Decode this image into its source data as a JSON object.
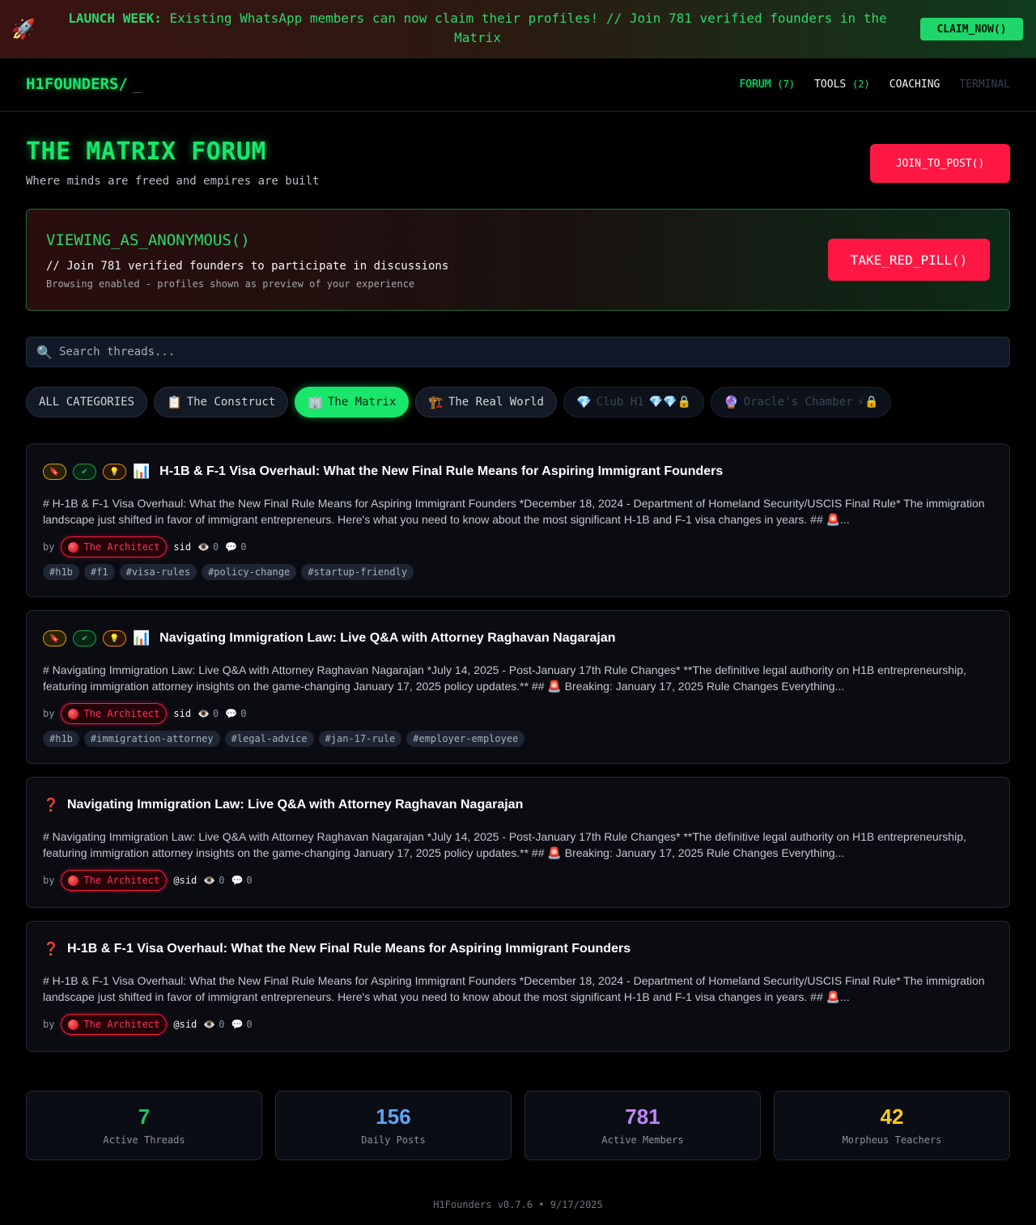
{
  "announcement": {
    "icon": "rocket-icon",
    "prefix": "LAUNCH WEEK:",
    "text": " Existing WhatsApp members can now claim their profiles! // Join 781 verified founders in the Matrix",
    "button": "CLAIM_NOW()"
  },
  "nav": {
    "brand": "H1FOUNDERS/",
    "cursor": "_",
    "forum": "FORUM",
    "forum_count": "(7)",
    "tools": "TOOLS",
    "tools_count": "(2)",
    "coaching": "COACHING",
    "terminal": "TERMINAL"
  },
  "header": {
    "title": "THE MATRIX FORUM",
    "subtitle": "Where minds are freed and empires are built",
    "join_button": "JOIN_TO_POST()"
  },
  "anon": {
    "title": "VIEWING_AS_ANONYMOUS()",
    "line": "// Join 781 verified founders to participate in discussions",
    "note": "Browsing enabled - profiles shown as preview of your experience",
    "button": "TAKE_RED_PILL()"
  },
  "search": {
    "placeholder": "Search threads..."
  },
  "categories": [
    {
      "emoji": "",
      "label": "ALL CATEGORIES",
      "extra": ""
    },
    {
      "emoji": "📋",
      "label": "The Construct",
      "extra": ""
    },
    {
      "emoji": "🏢",
      "label": "The Matrix",
      "extra": ""
    },
    {
      "emoji": "🏗️",
      "label": "The Real World",
      "extra": ""
    },
    {
      "emoji": "💎",
      "label": "Club H1",
      "extra": "💎💎🔒"
    },
    {
      "emoji": "🔮",
      "label": "Oracle's Chamber",
      "extra": "⚡🔒"
    }
  ],
  "threads": [
    {
      "title": "H-1B & F-1 Visa Overhaul: What the New Final Rule Means for Aspiring Immigrant Founders",
      "body": "# H-1B & F-1 Visa Overhaul: What the New Final Rule Means for Aspiring Immigrant Founders *December 18, 2024 - Department of Homeland Security/USCIS Final Rule* The immigration landscape just shifted in favor of immigrant entrepreneurs. Here's what you need to know about the most significant H-1B and F-1 visa changes in years. ## 🚨...",
      "by": "by",
      "author": "The Architect",
      "handle": "sid",
      "views": "0",
      "comments": "0",
      "tags": [
        "#h1b",
        "#f1",
        "#visa-rules",
        "#policy-change",
        "#startup-friendly"
      ]
    },
    {
      "title": "Navigating Immigration Law: Live Q&A with Attorney Raghavan Nagarajan",
      "body": "# Navigating Immigration Law: Live Q&A with Attorney Raghavan Nagarajan *July 14, 2025 - Post-January 17th Rule Changes* **The definitive legal authority on H1B entrepreneurship, featuring immigration attorney insights on the game-changing January 17, 2025 policy updates.** ## 🚨 Breaking: January 17, 2025 Rule Changes Everything...",
      "by": "by",
      "author": "The Architect",
      "handle": "sid",
      "views": "0",
      "comments": "0",
      "tags": [
        "#h1b",
        "#immigration-attorney",
        "#legal-advice",
        "#jan-17-rule",
        "#employer-employee"
      ]
    },
    {
      "title": "Navigating Immigration Law: Live Q&A with Attorney Raghavan Nagarajan",
      "body": "# Navigating Immigration Law: Live Q&A with Attorney Raghavan Nagarajan *July 14, 2025 - Post-January 17th Rule Changes* **The definitive legal authority on H1B entrepreneurship, featuring immigration attorney insights on the game-changing January 17, 2025 policy updates.** ## 🚨 Breaking: January 17, 2025 Rule Changes Everything...",
      "by": "by",
      "author": "The Architect",
      "handle": "@sid",
      "views": "0",
      "comments": "0"
    },
    {
      "title": "H-1B & F-1 Visa Overhaul: What the New Final Rule Means for Aspiring Immigrant Founders",
      "body": "# H-1B & F-1 Visa Overhaul: What the New Final Rule Means for Aspiring Immigrant Founders *December 18, 2024 - Department of Homeland Security/USCIS Final Rule* The immigration landscape just shifted in favor of immigrant entrepreneurs. Here's what you need to know about the most significant H-1B and F-1 visa changes in years. ## 🚨...",
      "by": "by",
      "author": "The Architect",
      "handle": "@sid",
      "views": "0",
      "comments": "0"
    }
  ],
  "stats": [
    {
      "value": "7",
      "label": "Active Threads",
      "color": "#22c55e"
    },
    {
      "value": "156",
      "label": "Daily Posts",
      "color": "#60a5fa"
    },
    {
      "value": "781",
      "label": "Active Members",
      "color": "#c084fc"
    },
    {
      "value": "42",
      "label": "Morpheus Teachers",
      "color": "#facc15"
    }
  ],
  "footer": "H1Founders v0.7.6 • 9/17/2025"
}
